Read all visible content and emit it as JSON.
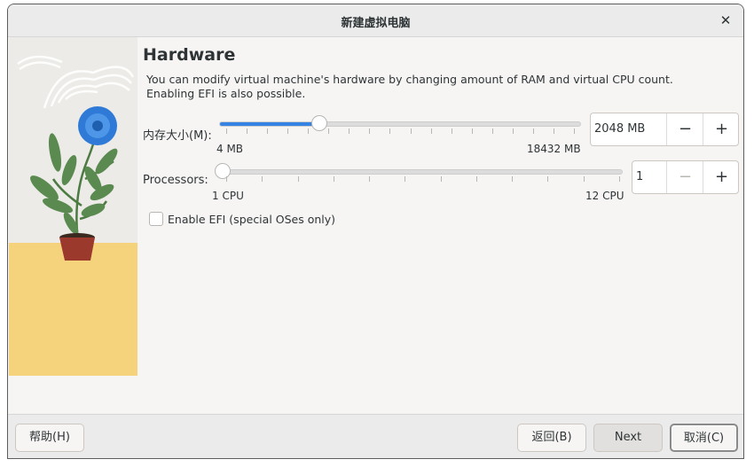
{
  "window": {
    "title": "新建虚拟电脑",
    "close_icon": "close-icon"
  },
  "page": {
    "heading": "Hardware",
    "description": "You can modify virtual machine's hardware by changing amount of RAM and virtual CPU count. Enabling EFI is also possible."
  },
  "memory": {
    "label": "内存大小(M):",
    "min_label": "4 MB",
    "max_label": "18432 MB",
    "value": "2048 MB",
    "value_mb": 2048,
    "min_mb": 4,
    "max_mb": 18432,
    "decrement_label": "−",
    "increment_label": "+"
  },
  "processors": {
    "label": "Processors:",
    "min_label": "1 CPU",
    "max_label": "12 CPU",
    "value": "1",
    "value_num": 1,
    "min_num": 1,
    "max_num": 12,
    "decrement_label": "−",
    "increment_label": "+",
    "decrement_disabled": true
  },
  "efi": {
    "label": "Enable EFI (special OSes only)",
    "checked": false
  },
  "footer": {
    "help_label": "帮助(H)",
    "back_label": "返回(B)",
    "next_label": "Next",
    "cancel_label": "取消(C)"
  },
  "colors": {
    "accent": "#3584e4",
    "window_bg": "#f6f5f4",
    "floor": "#f5d37c",
    "flower": "#2f7ad6",
    "leaf": "#5a8a4f",
    "pot": "#9b3a2c"
  }
}
